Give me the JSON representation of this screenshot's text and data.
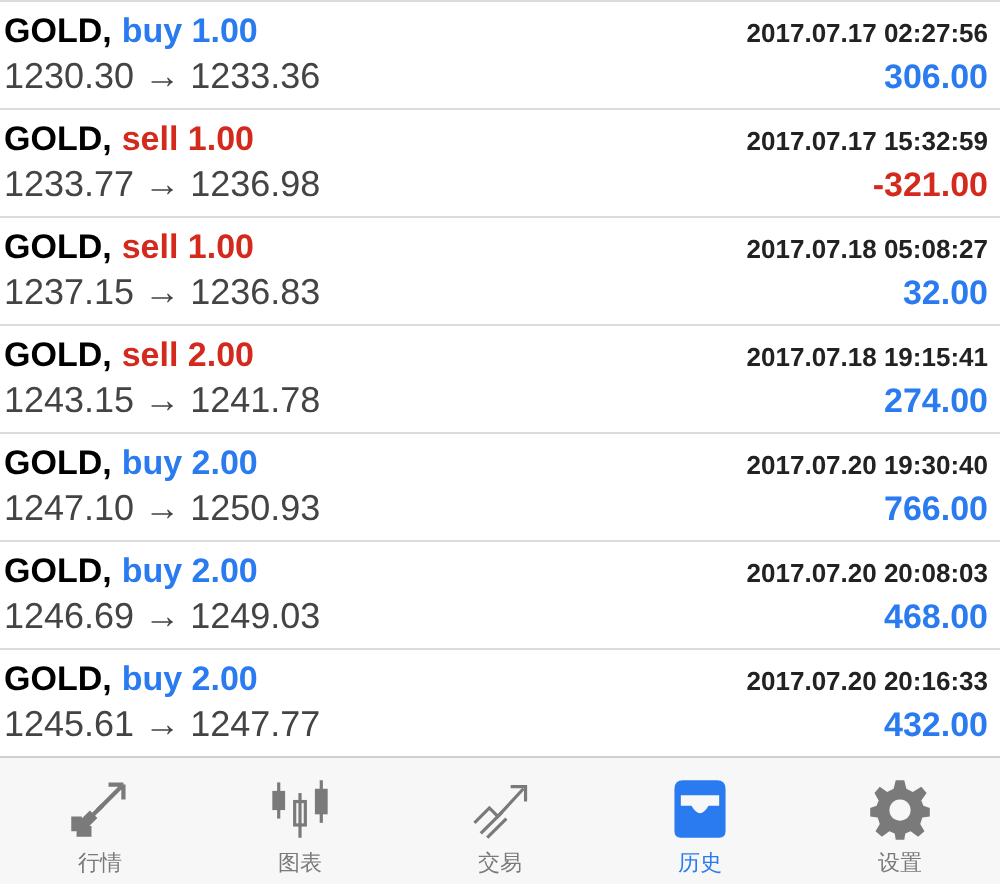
{
  "deals": [
    {
      "symbol": "GOLD,",
      "side": "buy",
      "volume": "1.00",
      "prices": "1230.30 → 1233.36",
      "time": "2017.07.17 02:27:56",
      "profit": "306.00",
      "loss": false
    },
    {
      "symbol": "GOLD,",
      "side": "sell",
      "volume": "1.00",
      "prices": "1233.77 → 1236.98",
      "time": "2017.07.17 15:32:59",
      "profit": "-321.00",
      "loss": true
    },
    {
      "symbol": "GOLD,",
      "side": "sell",
      "volume": "1.00",
      "prices": "1237.15 → 1236.83",
      "time": "2017.07.18 05:08:27",
      "profit": "32.00",
      "loss": false
    },
    {
      "symbol": "GOLD,",
      "side": "sell",
      "volume": "2.00",
      "prices": "1243.15 → 1241.78",
      "time": "2017.07.18 19:15:41",
      "profit": "274.00",
      "loss": false
    },
    {
      "symbol": "GOLD,",
      "side": "buy",
      "volume": "2.00",
      "prices": "1247.10 → 1250.93",
      "time": "2017.07.20 19:30:40",
      "profit": "766.00",
      "loss": false
    },
    {
      "symbol": "GOLD,",
      "side": "buy",
      "volume": "2.00",
      "prices": "1246.69 → 1249.03",
      "time": "2017.07.20 20:08:03",
      "profit": "468.00",
      "loss": false
    },
    {
      "symbol": "GOLD,",
      "side": "buy",
      "volume": "2.00",
      "prices": "1245.61 → 1247.77",
      "time": "2017.07.20 20:16:33",
      "profit": "432.00",
      "loss": false
    }
  ],
  "tabs": [
    {
      "label": "行情",
      "kind": "quotes",
      "selected": false
    },
    {
      "label": "图表",
      "kind": "chart",
      "selected": false
    },
    {
      "label": "交易",
      "kind": "trade",
      "selected": false
    },
    {
      "label": "历史",
      "kind": "history",
      "selected": true
    },
    {
      "label": "设置",
      "kind": "settings",
      "selected": false
    }
  ]
}
